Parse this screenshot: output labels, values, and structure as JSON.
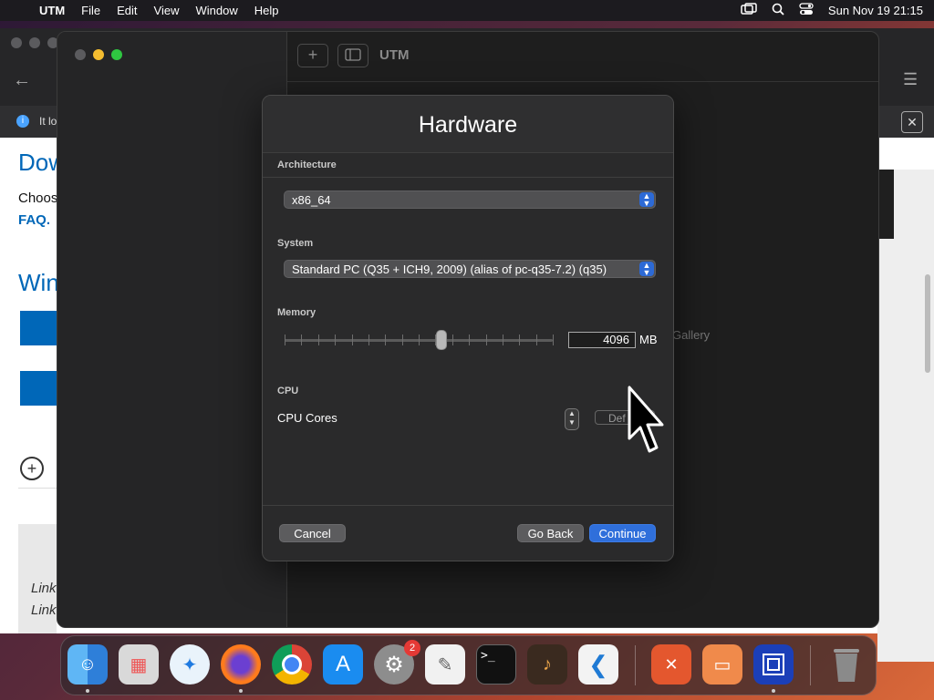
{
  "menubar": {
    "app": "UTM",
    "items": [
      "File",
      "Edit",
      "View",
      "Window",
      "Help"
    ],
    "clock": "Sun Nov 19  21:15"
  },
  "background_browser": {
    "info_text": "It lo",
    "heading1": "Dow",
    "line1": "Choos",
    "faq": "FAQ.",
    "heading2": "Win",
    "link1": "Link",
    "link2": "Link"
  },
  "utm_window": {
    "title": "UTM",
    "gallery_hint": "Gallery"
  },
  "dialog": {
    "title": "Hardware",
    "architecture_label": "Architecture",
    "architecture_value": "x86_64",
    "system_label": "System",
    "system_value": "Standard PC (Q35 + ICH9, 2009) (alias of pc-q35-7.2) (q35)",
    "memory_label": "Memory",
    "memory_value": "4096",
    "memory_unit": "MB",
    "memory_slider_fraction": 0.58,
    "cpu_section_label": "CPU",
    "cpu_cores_label": "CPU Cores",
    "cpu_default_label": "Def",
    "buttons": {
      "cancel": "Cancel",
      "go_back": "Go Back",
      "continue": "Continue"
    }
  },
  "dock": {
    "apps": [
      "finder-icon",
      "launchpad-icon",
      "safari-icon",
      "firefox-icon",
      "chrome-icon",
      "app-store-icon",
      "system-settings-icon",
      "textedit-icon",
      "terminal-icon",
      "garageband-icon",
      "vscode-icon",
      "remote-desktop-icon",
      "screen-sharing-icon",
      "utm-icon",
      "trash-icon"
    ],
    "settings_badge": "2"
  },
  "colors": {
    "accent": "#2f6fdb",
    "dialog_bg": "#2a2a2b",
    "menubar": "#1c1b1f"
  }
}
